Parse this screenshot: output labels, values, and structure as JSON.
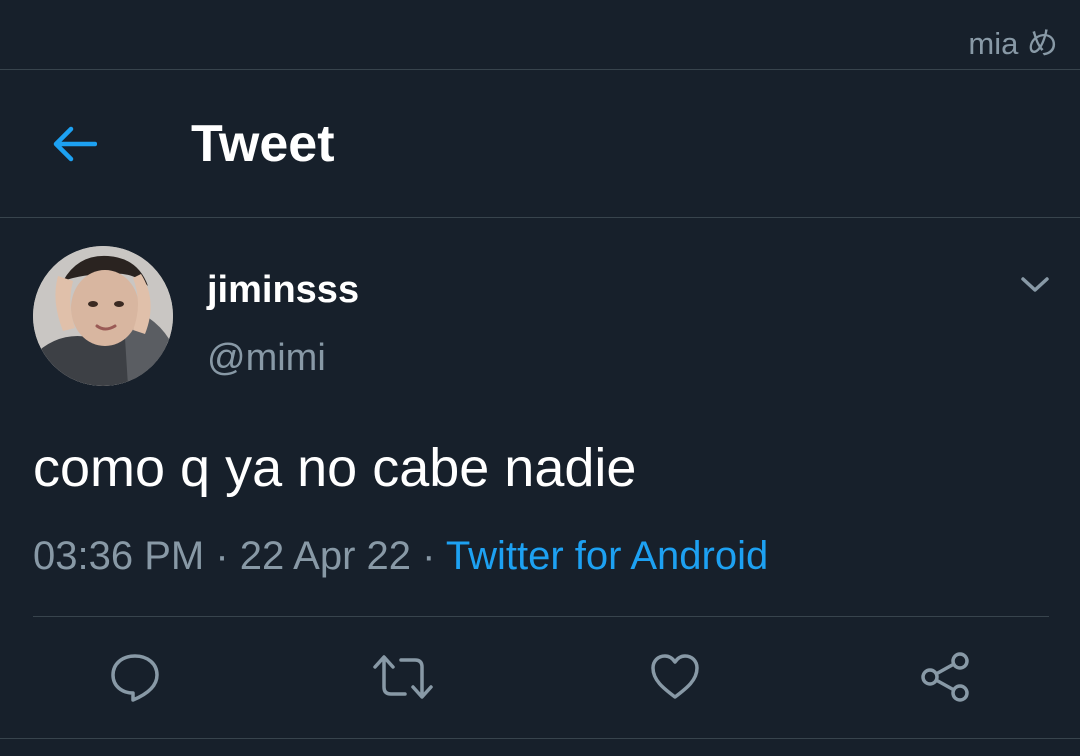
{
  "watermark": "mia め",
  "header": {
    "back_icon": "arrow-left-icon",
    "title": "Tweet"
  },
  "tweet": {
    "display_name": "jiminsss",
    "handle": "@mimi",
    "more_icon": "chevron-down-icon",
    "text": "como q ya no cabe nadie",
    "time": "03:36 PM",
    "separator": " · ",
    "date": "22 Apr 22",
    "source": "Twitter for Android"
  },
  "actions": [
    {
      "icon": "reply-icon"
    },
    {
      "icon": "retweet-icon"
    },
    {
      "icon": "like-icon"
    },
    {
      "icon": "share-icon"
    }
  ],
  "colors": {
    "background": "#17202b",
    "accent": "#1da1f2",
    "secondary_text": "#8899a6",
    "divider": "#38444d"
  }
}
